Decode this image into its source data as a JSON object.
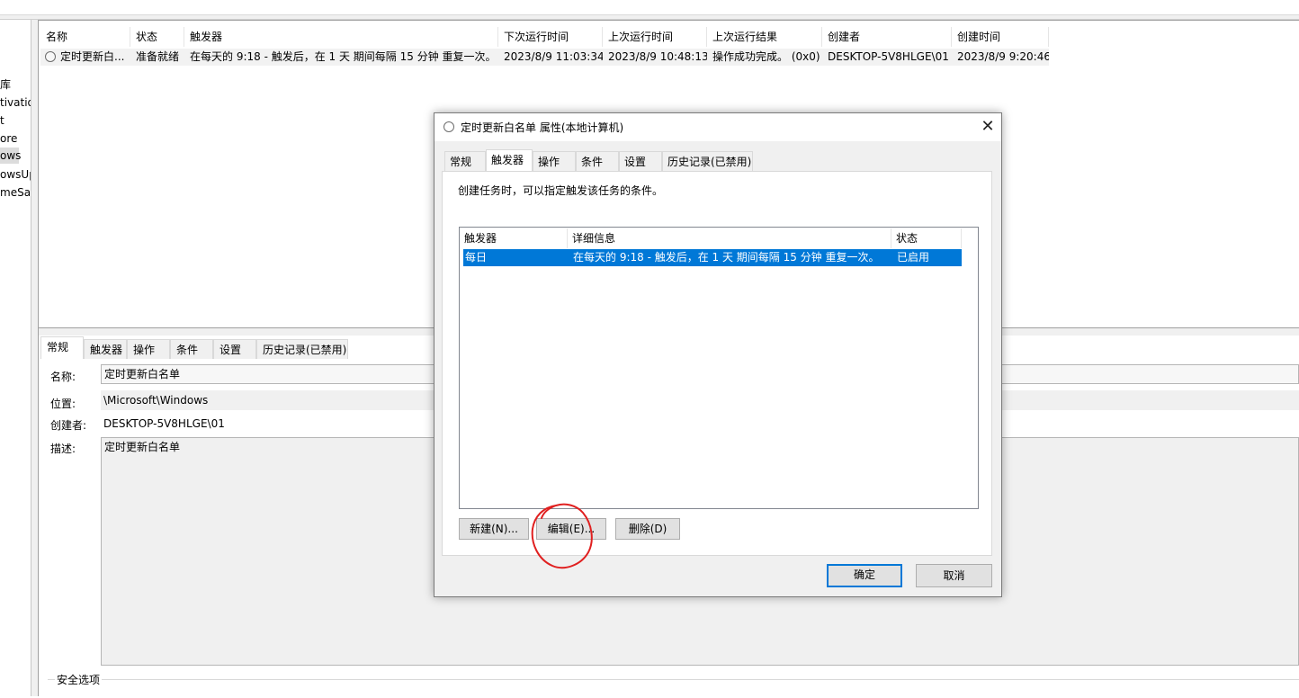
{
  "tree": {
    "items": [
      "库",
      "tivatio",
      "t",
      "ore",
      "ows",
      "owsUp",
      "meSa"
    ]
  },
  "task_list": {
    "columns": [
      "名称",
      "状态",
      "触发器",
      "下次运行时间",
      "上次运行时间",
      "上次运行结果",
      "创建者",
      "创建时间"
    ],
    "rows": [
      {
        "name": "定时更新白...",
        "status": "准备就绪",
        "trigger": "在每天的 9:18 - 触发后，在 1 天 期间每隔 15 分钟 重复一次。",
        "next_run": "2023/8/9 11:03:34",
        "last_run": "2023/8/9 10:48:13",
        "last_result": "操作成功完成。 (0x0)",
        "author": "DESKTOP-5V8HLGE\\01",
        "created": "2023/8/9 9:20:46"
      }
    ]
  },
  "detail": {
    "tabs": [
      "常规",
      "触发器",
      "操作",
      "条件",
      "设置",
      "历史记录(已禁用)"
    ],
    "name_label": "名称:",
    "name_value": "定时更新白名单",
    "location_label": "位置:",
    "location_value": "\\Microsoft\\Windows",
    "author_label": "创建者:",
    "author_value": "DESKTOP-5V8HLGE\\01",
    "desc_label": "描述:",
    "desc_value": "定时更新白名单",
    "security_label": "安全选项"
  },
  "dialog": {
    "title": "定时更新白名单 属性(本地计算机)",
    "close_glyph": "✕",
    "tabs": [
      "常规",
      "触发器",
      "操作",
      "条件",
      "设置",
      "历史记录(已禁用)"
    ],
    "active_tab": "触发器",
    "description": "创建任务时，可以指定触发该任务的条件。",
    "trigger_columns": [
      "触发器",
      "详细信息",
      "状态"
    ],
    "triggers": [
      {
        "trigger": "每日",
        "details": "在每天的 9:18 - 触发后，在 1 天 期间每隔 15 分钟 重复一次。",
        "status": "已启用"
      }
    ],
    "buttons": {
      "new": "新建(N)...",
      "edit": "编辑(E)...",
      "delete": "删除(D)",
      "ok": "确定",
      "cancel": "取消"
    }
  },
  "colors": {
    "selection": "#0078d7",
    "annotation": "#e02020"
  }
}
